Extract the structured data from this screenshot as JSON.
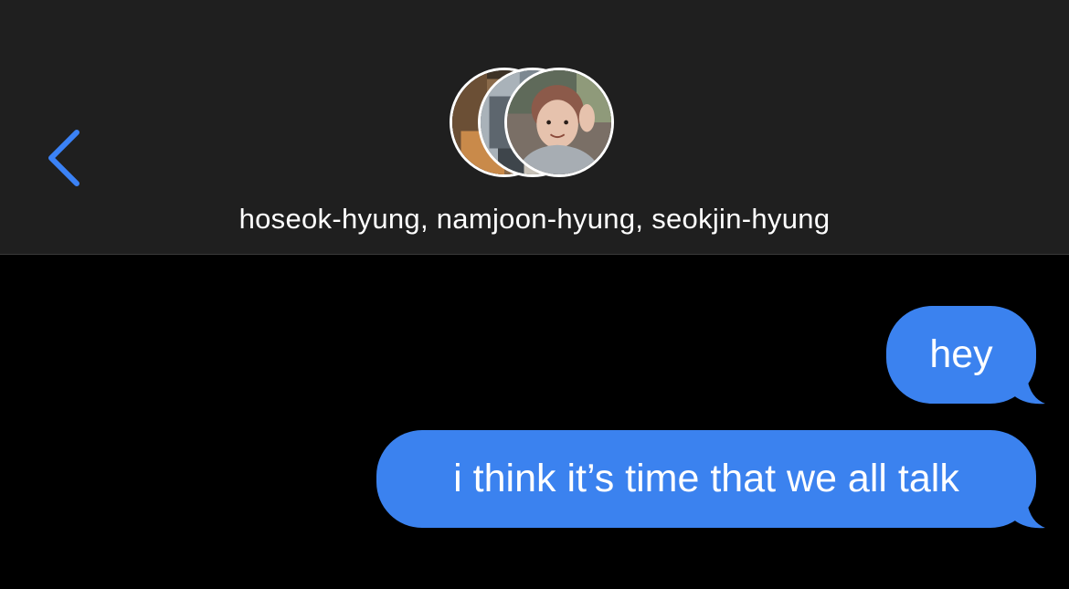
{
  "header": {
    "title": "hoseok-hyung, namjoon-hyung, seokjin-hyung",
    "back_icon": "chevron-left-icon",
    "accent_color": "#3b82f6",
    "background_color": "#1f1f1f"
  },
  "avatars": [
    {
      "name": "avatar-hoseok",
      "tone": "#8a6a4a"
    },
    {
      "name": "avatar-namjoon",
      "tone": "#9aa3ac"
    },
    {
      "name": "avatar-seokjin",
      "tone": "#c9a89a"
    }
  ],
  "messages": [
    {
      "text": "hey",
      "direction": "outgoing"
    },
    {
      "text": "i think it’s time that we all talk",
      "direction": "outgoing"
    }
  ],
  "colors": {
    "bubble": "#3b82ef",
    "bubble_text": "#ffffff",
    "chat_background": "#000000"
  }
}
